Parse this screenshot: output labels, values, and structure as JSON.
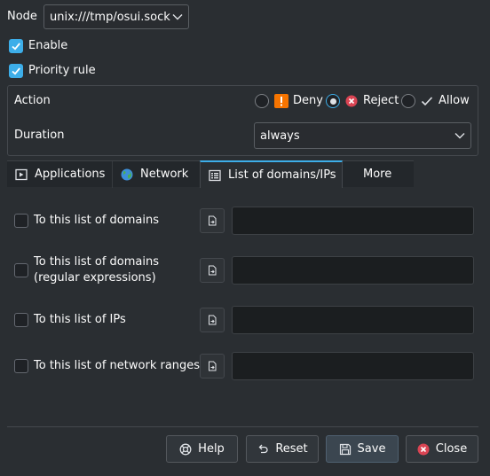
{
  "node": {
    "label": "Node",
    "value": "unix:///tmp/osui.sock"
  },
  "enable": {
    "label": "Enable",
    "checked": true
  },
  "priority": {
    "label": "Priority rule",
    "checked": true
  },
  "action": {
    "label": "Action",
    "options": [
      {
        "label": "Deny",
        "selected": false,
        "icon": "warning-icon"
      },
      {
        "label": "Reject",
        "selected": true,
        "icon": "reject-icon"
      },
      {
        "label": "Allow",
        "selected": false,
        "icon": "check-icon"
      }
    ]
  },
  "duration": {
    "label": "Duration",
    "value": "always"
  },
  "tabs": [
    {
      "label": "Applications",
      "icon": "applications-icon",
      "active": false
    },
    {
      "label": "Network",
      "icon": "globe-icon",
      "active": false
    },
    {
      "label": "List of domains/IPs",
      "icon": "list-icon",
      "active": true
    },
    {
      "label": "More",
      "icon": "",
      "active": false
    }
  ],
  "lists": [
    {
      "label": "To this list of domains",
      "value": ""
    },
    {
      "label": "To this list of domains\n(regular expressions)",
      "label_line1": "To this list of domains",
      "label_line2": "(regular expressions)",
      "value": ""
    },
    {
      "label": "To this list of IPs",
      "value": ""
    },
    {
      "label": "To this list of network ranges",
      "value": ""
    }
  ],
  "buttons": {
    "help": "Help",
    "reset": "Reset",
    "save": "Save",
    "close": "Close"
  },
  "colors": {
    "background": "#2a2e32",
    "accent": "#3daee9",
    "warning": "#f67400",
    "reject": "#da4453"
  }
}
